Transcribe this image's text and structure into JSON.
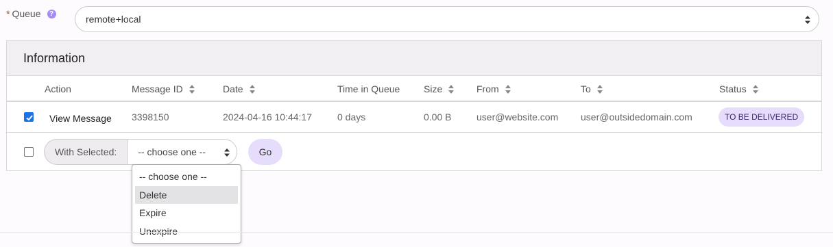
{
  "queue": {
    "label": "Queue",
    "required_marker": "*",
    "help_icon_char": "?",
    "selected_value": "remote+local"
  },
  "panel": {
    "title": "Information"
  },
  "table": {
    "columns": [
      {
        "label": "Action",
        "sortable": false
      },
      {
        "label": "Message ID",
        "sortable": true
      },
      {
        "label": "Date",
        "sortable": true
      },
      {
        "label": "Time in Queue",
        "sortable": false
      },
      {
        "label": "Size",
        "sortable": true
      },
      {
        "label": "From",
        "sortable": true
      },
      {
        "label": "To",
        "sortable": true
      },
      {
        "label": "Status",
        "sortable": true
      }
    ],
    "rows": [
      {
        "checked": true,
        "action": "View Message",
        "message_id": "3398150",
        "date": "2024-04-16 10:44:17",
        "time_in_queue": "0 days",
        "size": "0.00 B",
        "from": "user@website.com",
        "to": "user@outsidedomain.com",
        "status": "TO BE DELIVERED"
      }
    ]
  },
  "bulk_action": {
    "checked": false,
    "label": "With Selected:",
    "selected_value": "-- choose one --",
    "go_label": "Go",
    "options": [
      "-- choose one --",
      "Delete",
      "Expire",
      "Unexpire"
    ],
    "highlighted_option": "Delete"
  },
  "colors": {
    "accent": "#e6dcfb",
    "checkbox_checked": "#1a73e8",
    "help_icon": "#a78bfa",
    "required": "#c0392b"
  }
}
